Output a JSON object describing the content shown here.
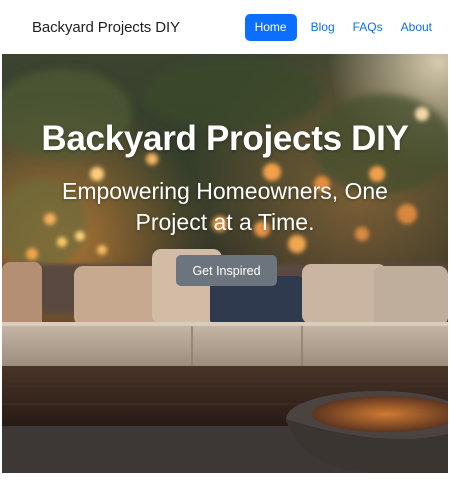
{
  "navbar": {
    "brand": "Backyard Projects DIY",
    "links": [
      {
        "label": "Home",
        "active": true
      },
      {
        "label": "Blog",
        "active": false
      },
      {
        "label": "FAQs",
        "active": false
      },
      {
        "label": "About",
        "active": false
      }
    ]
  },
  "hero": {
    "title": "Backyard Projects DIY",
    "subtitle": "Empowering Homeowners, One Project at a Time.",
    "cta_label": "Get Inspired",
    "image_subject": "outdoor patio with sectional sofa, fire pit and string lights at dusk"
  },
  "colors": {
    "primary": "#0d6efd",
    "secondary": "#6c757d",
    "text_dark": "#1f1f1f"
  }
}
